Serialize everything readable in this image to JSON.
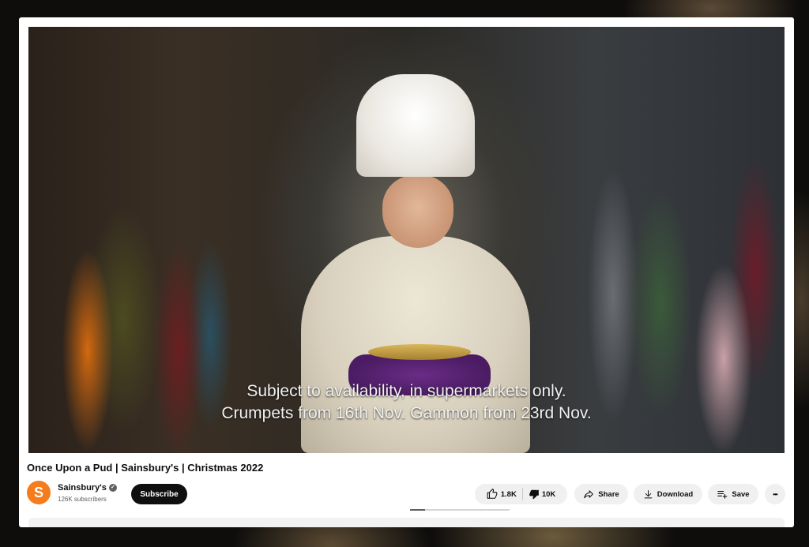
{
  "video": {
    "subtitle_line1": "Subject to availability, in supermarkets only.",
    "subtitle_line2": "Crumpets from 16th Nov. Gammon from 23rd Nov."
  },
  "title": "Once Upon a Pud | Sainsbury's | Christmas 2022",
  "channel": {
    "avatar_letter": "S",
    "name": "Sainsbury's",
    "subscribers": "126K subscribers",
    "avatar_color": "#f47c1c"
  },
  "actions": {
    "subscribe_label": "Subscribe",
    "likes": "1.8K",
    "dislikes": "10K",
    "share_label": "Share",
    "download_label": "Download",
    "save_label": "Save",
    "more_label": "•••"
  },
  "icons": {
    "like": "thumbs-up-icon",
    "dislike": "thumbs-down-icon",
    "share": "share-arrow-icon",
    "download": "download-icon",
    "save": "playlist-add-icon",
    "more": "more-horizontal-icon",
    "verified": "verified-check-icon"
  },
  "progress": {
    "fraction": 0.15
  }
}
